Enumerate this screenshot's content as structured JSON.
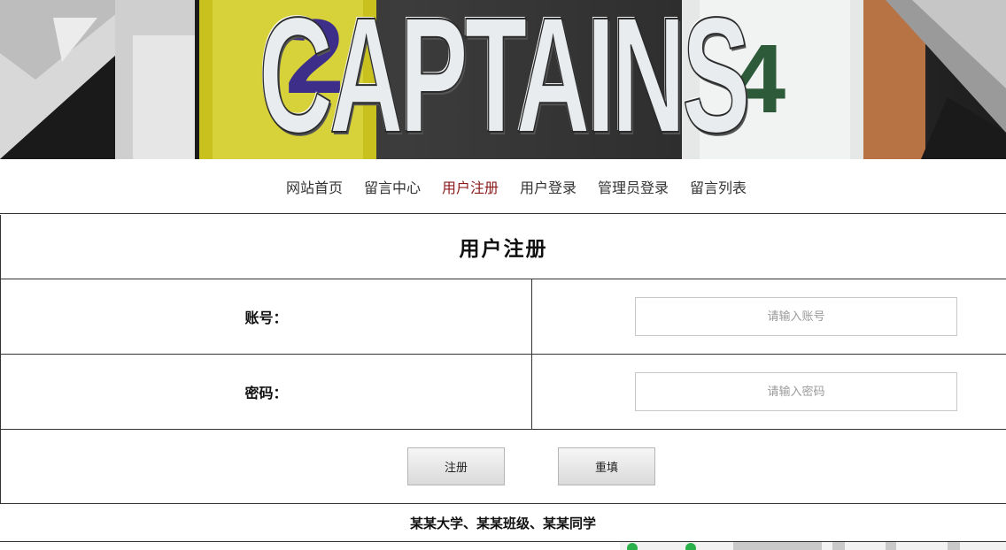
{
  "banner": {
    "title": "CAPTAINS",
    "jersey_left_number": "2",
    "jersey_right_number": "4"
  },
  "nav": {
    "items": [
      {
        "label": "网站首页",
        "active": false
      },
      {
        "label": "留言中心",
        "active": false
      },
      {
        "label": "用户注册",
        "active": true
      },
      {
        "label": "用户登录",
        "active": false
      },
      {
        "label": "管理员登录",
        "active": false
      },
      {
        "label": "留言列表",
        "active": false
      }
    ]
  },
  "form": {
    "heading": "用户注册",
    "account_label": "账号：",
    "account_placeholder": "请输入账号",
    "account_value": "",
    "password_label": "密码：",
    "password_placeholder": "请输入密码",
    "password_value": "",
    "submit_label": "注册",
    "reset_label": "重填"
  },
  "footer": {
    "text": "某某大学、某某班级、某某同学"
  },
  "colors": {
    "nav_active": "#8b1b1b",
    "border": "#333333",
    "status_green": "#2bb14c"
  }
}
